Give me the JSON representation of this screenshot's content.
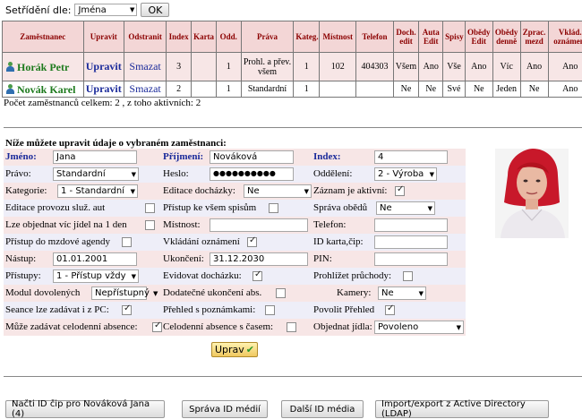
{
  "sort": {
    "label": "Setřídění dle:",
    "value": "Jména",
    "ok": "OK"
  },
  "table": {
    "headers": [
      "Zaměstnanec",
      "Upravit",
      "Odstranit",
      "Index",
      "Karta",
      "Odd.",
      "Práva",
      "Kateg.",
      "Místnost",
      "Telefon",
      "Doch. edit",
      "Auta Edit",
      "Spisy",
      "Obědy Edit",
      "Obědy denně",
      "Zprac. mezd",
      "Vklád. oznámení"
    ],
    "rows": [
      [
        "Horák Petr",
        "Upravit",
        "Smazat",
        "3",
        "",
        "1",
        "Prohl. a přev. všem",
        "1",
        "102",
        "404303",
        "Všem",
        "Ano",
        "Vše",
        "Ano",
        "Víc",
        "Ano",
        "Ano"
      ],
      [
        "Novák Karel",
        "Upravit",
        "Smazat",
        "2",
        "",
        "1",
        "Standardní",
        "1",
        "",
        "",
        "Ne",
        "Ne",
        "Své",
        "Ne",
        "Jeden",
        "Ne",
        "Ano"
      ]
    ]
  },
  "count_text": "Počet zaměstnanců celkem: 2 , z toho aktivních: 2",
  "form": {
    "title": "Níže můžete upravit údaje o vybraném zaměstnanci:",
    "jmeno_label": "Jméno:",
    "jmeno_value": "Jana",
    "prijmeni_label": "Příjmení:",
    "prijmeni_value": "Nováková",
    "index_label": "Index:",
    "index_value": "4",
    "pravo_label": "Právo:",
    "pravo_value": "Standardní",
    "heslo_label": "Heslo:",
    "heslo_value": "●●●●●●●●●●",
    "oddeleni_label": "Oddělení:",
    "oddeleni_value": "2 - Výroba",
    "kategorie_label": "Kategorie:",
    "kategorie_value": "1 - Standardní",
    "editace_label": "Editace docházky:",
    "editace_value": "Ne",
    "zaznam_label": "Záznam je aktivní:",
    "provoz_label": "Editace provozu služ. aut",
    "spisy_label": "Přístup ke všem spisům",
    "obedy_label": "Správa obědů",
    "obedy_value": "Ne",
    "vice_jidel_label": "Lze objednat víc jídel na 1 den",
    "mistnost_label": "Místnost:",
    "telefon_label": "Telefon:",
    "mzdy_label": "Přístup do mzdové agendy",
    "oznameni_label": "Vkládání oznámení",
    "idkarta_label": "ID karta,čip:",
    "nastup_label": "Nástup:",
    "nastup_value": "01.01.2001",
    "ukonceni_label": "Ukončení:",
    "ukonceni_value": "31.12.2030",
    "pin_label": "PIN:",
    "pristupy_label": "Přístupy:",
    "pristupy_value": "1 - Přístup vždy",
    "evidovat_label": "Evidovat docházku:",
    "pruchody_label": "Prohlížet průchody:",
    "modul_label": "Modul dovolených",
    "modul_value": "Nepřístupný",
    "dodatecne_label": "Dodatečné ukončení abs.",
    "kamery_label": "Kamery:",
    "kamery_value": "Ne",
    "seance_label": "Seance lze zadávat i z PC:",
    "prehled_label": "Přehled s poznámkami:",
    "povolit_label": "Povolit Přehled",
    "celodenni_label": "Může zadávat celodenní absence:",
    "cel_cas_label": "Celodenní absence s časem:",
    "jidla_label": "Objednat jídla:",
    "jidla_value": "Povoleno",
    "uprav": "Uprav"
  },
  "buttons": {
    "nacti": "Načti ID čip pro Nováková Jana (4)",
    "sprava": "Správa ID médií",
    "dalsi": "Další ID média",
    "ldap": "Import/export z Active Directory (LDAP)"
  },
  "colors": {
    "header_bg": "#f3d6d6",
    "header_text": "#8b0000",
    "link": "#1a2a9a",
    "name_green": "#1d7a1d",
    "row_pink": "#f7e6e6",
    "row_lav": "#eeeef8"
  }
}
